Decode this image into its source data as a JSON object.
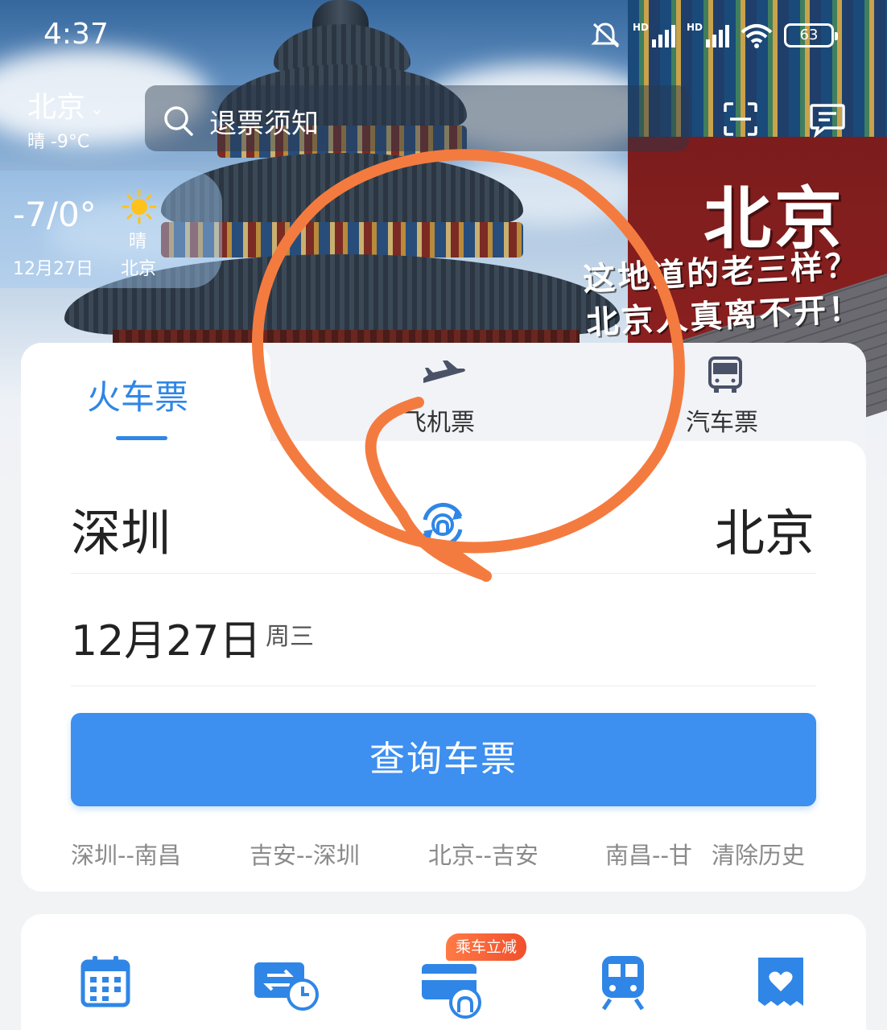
{
  "status_bar": {
    "time": "4:37",
    "hd1": "HD",
    "hd2": "HD",
    "battery": "63"
  },
  "header": {
    "city": "北京",
    "city_weather": "晴 -9°C",
    "search_placeholder": "退票须知"
  },
  "weather_card": {
    "temp_range": "-7/0°",
    "date": "12月27日",
    "condition": "晴",
    "city": "北京"
  },
  "banner": {
    "title": "北京",
    "line1": "这地道的老三样？",
    "line2": "北京人真离不开！"
  },
  "tabs": [
    {
      "label": "火车票",
      "active": true
    },
    {
      "label": "飞机票",
      "active": false
    },
    {
      "label": "汽车票",
      "active": false
    }
  ],
  "form": {
    "from_city": "深圳",
    "to_city": "北京",
    "date": "12月27日",
    "weekday": "周三",
    "query_label": "查询车票"
  },
  "history": {
    "items": [
      "深圳--南昌",
      "吉安--深圳",
      "北京--吉安",
      "南昌--甘"
    ],
    "clear_label": "清除历史"
  },
  "quick_entries": {
    "promo_badge": "乘车立减",
    "icons": [
      "calendar-icon",
      "ticket-change-icon",
      "rail-card-icon",
      "train-icon",
      "gift-ticket-icon"
    ]
  },
  "colors": {
    "accent": "#2f86e6",
    "button": "#3d8ff0",
    "annotation": "#f47b3f",
    "promo": "#f0502c"
  }
}
